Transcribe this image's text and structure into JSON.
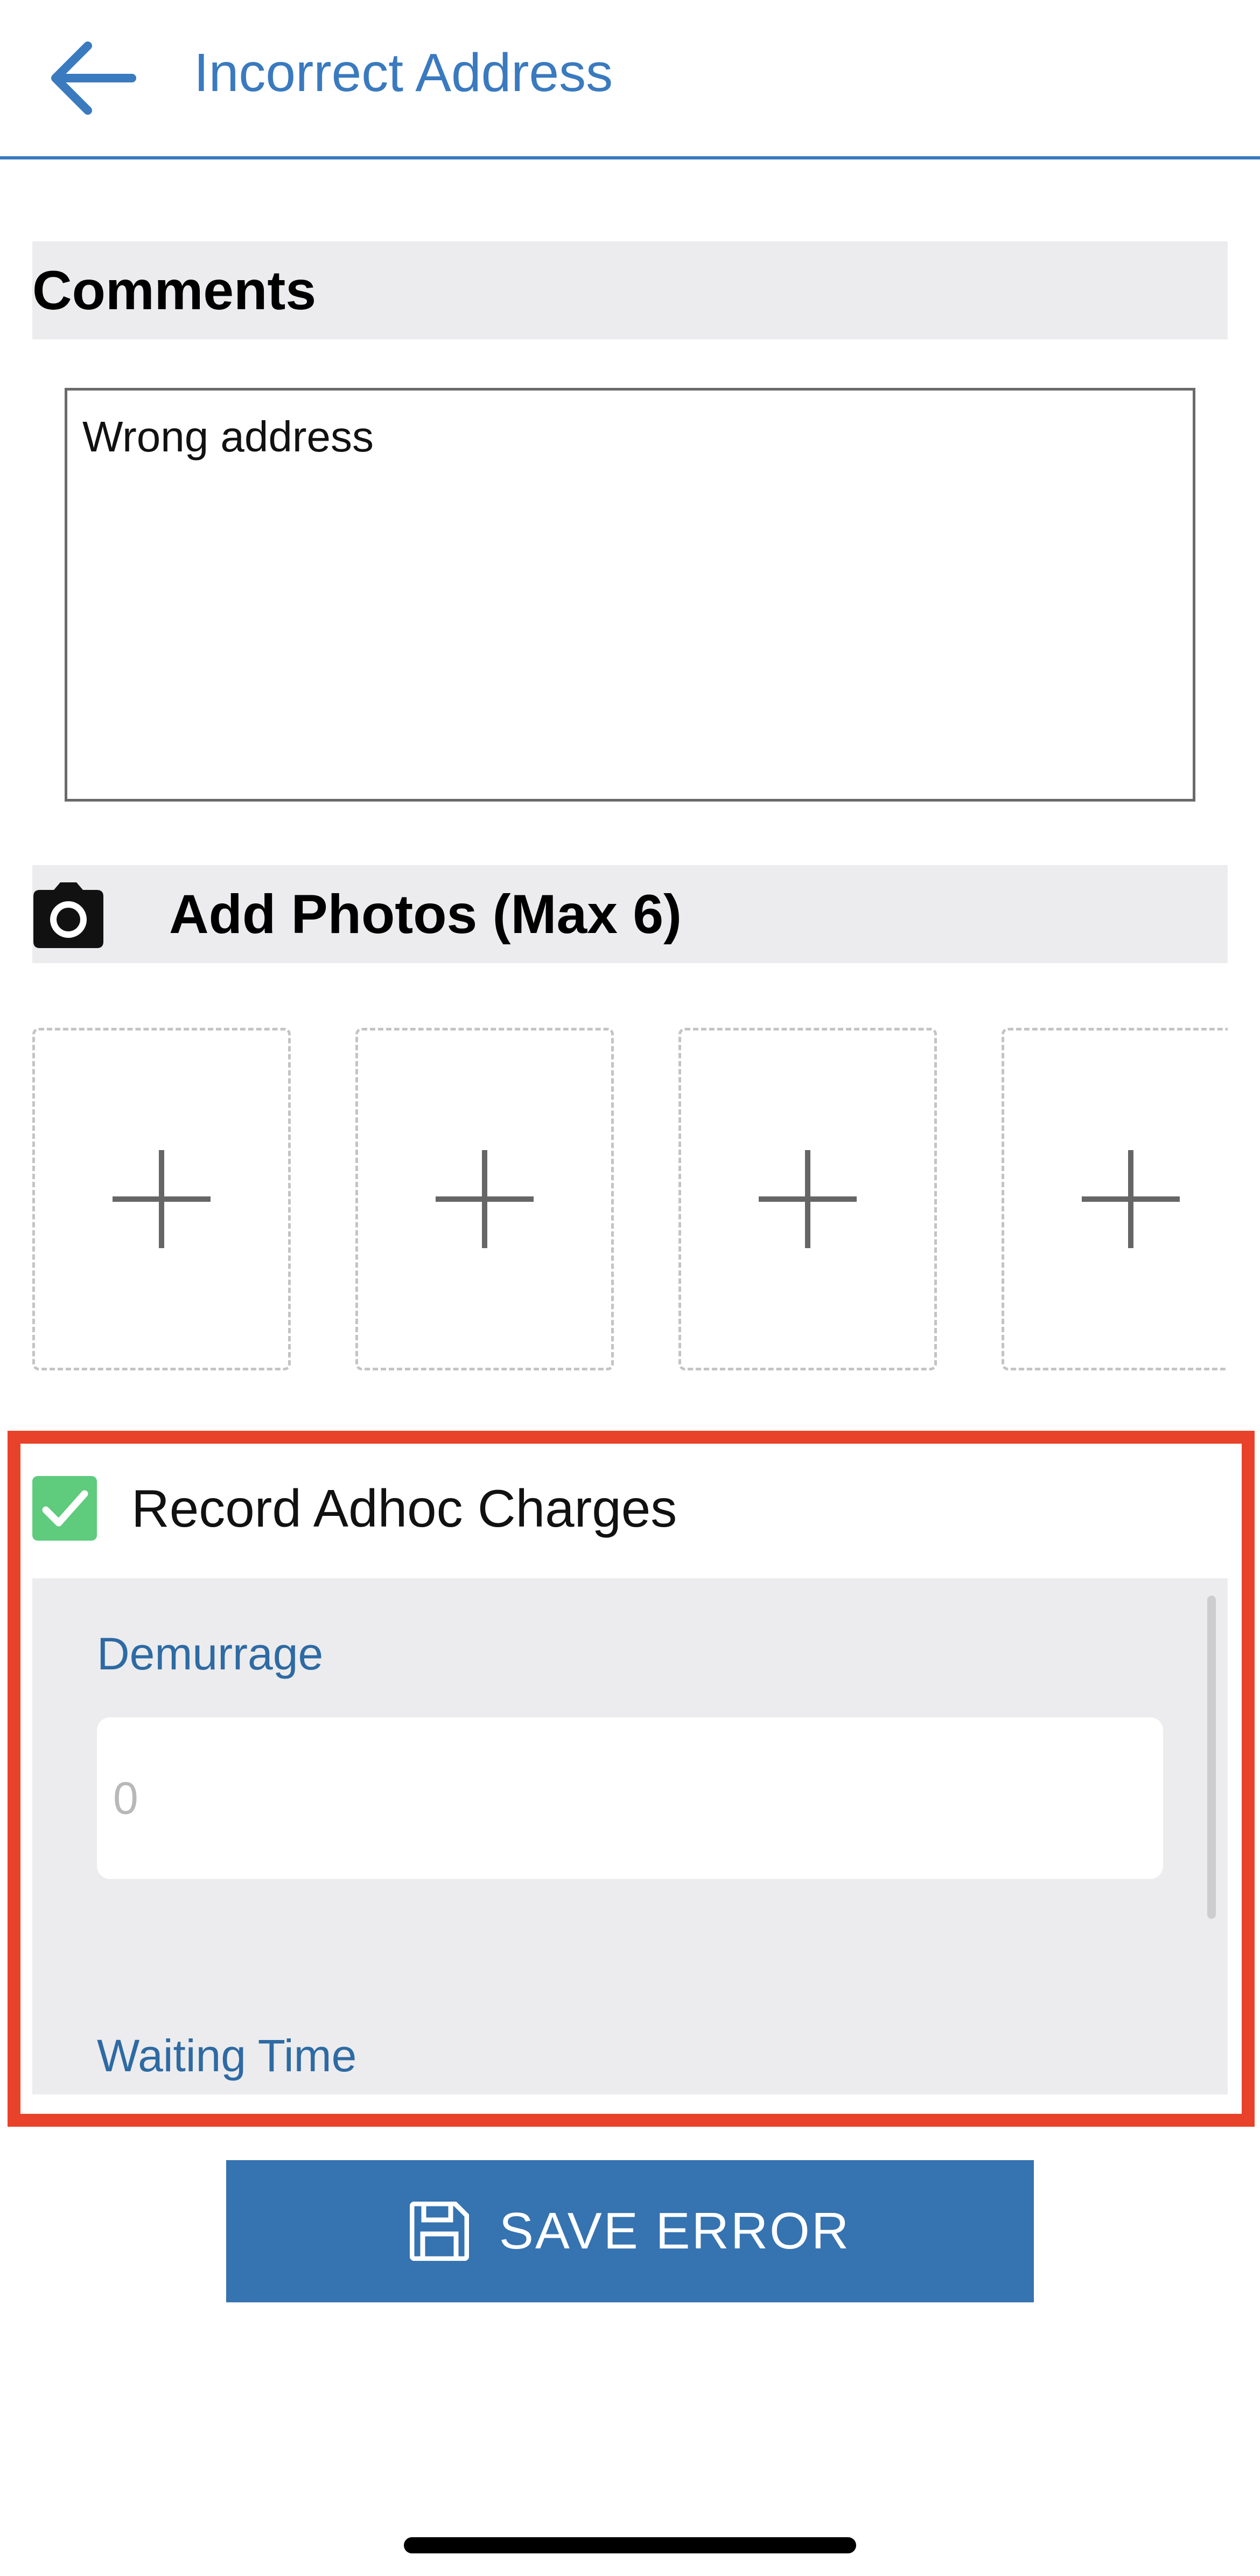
{
  "header": {
    "title": "Incorrect Address",
    "back_icon": "arrow-left-icon",
    "accent_color": "#3a7abf"
  },
  "comments": {
    "title": "Comments",
    "value": "Wrong address"
  },
  "photos": {
    "title": "Add Photos (Max 6)",
    "icon": "camera-icon",
    "slots": [
      {
        "icon": "plus-icon"
      },
      {
        "icon": "plus-icon"
      },
      {
        "icon": "plus-icon"
      },
      {
        "icon": "plus-icon"
      }
    ]
  },
  "adhoc": {
    "checkbox_label": "Record Adhoc Charges",
    "checked": true,
    "checkbox_color": "#5ecb7d",
    "fields": [
      {
        "label": "Demurrage",
        "placeholder": "0"
      },
      {
        "label": "Waiting Time"
      }
    ]
  },
  "save": {
    "label": "SAVE ERROR",
    "icon": "floppy-disk-icon",
    "color": "#3573b1"
  },
  "highlight_color": "#e8432a"
}
